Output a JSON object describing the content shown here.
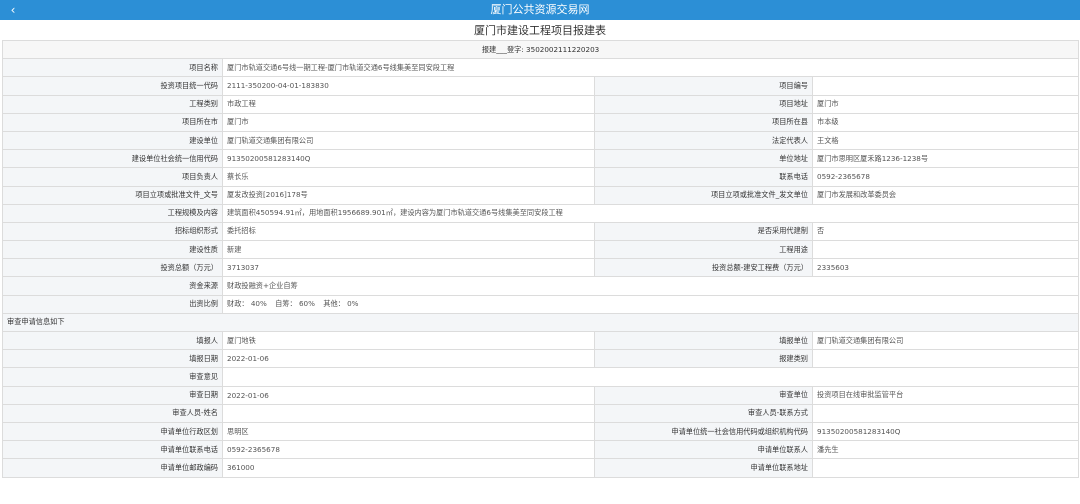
{
  "header": {
    "back_icon": "‹",
    "title": "厦门公共资源交易网"
  },
  "page_title": "厦门市建设工程项目报建表",
  "registration_line": "报建___登字: 3502002111220203",
  "fields": {
    "project_name": {
      "label": "项目名称",
      "value": "厦门市轨道交通6号线一期工程-厦门市轨道交通6号线集美至同安段工程"
    },
    "project_code": {
      "label": "投资项目统一代码",
      "value": "2111-350200-04-01-183830"
    },
    "project_number": {
      "label": "项目编号",
      "value": ""
    },
    "project_category": {
      "label": "工程类别",
      "value": "市政工程"
    },
    "project_address": {
      "label": "项目地址",
      "value": "厦门市"
    },
    "city": {
      "label": "项目所在市",
      "value": "厦门市"
    },
    "county": {
      "label": "项目所在县",
      "value": "市本级"
    },
    "builder": {
      "label": "建设单位",
      "value": "厦门轨道交通集团有限公司"
    },
    "legal_rep": {
      "label": "法定代表人",
      "value": "王文格"
    },
    "credit_code": {
      "label": "建设单位社会统一信用代码",
      "value": "91350200581283140Q"
    },
    "unit_address": {
      "label": "单位地址",
      "value": "厦门市思明区厦禾路1236-1238号"
    },
    "project_leader": {
      "label": "项目负责人",
      "value": "蔡长乐"
    },
    "phone": {
      "label": "联系电话",
      "value": "0592-2365678"
    },
    "approval_doc": {
      "label": "项目立项或批准文件_文号",
      "value": "厦发改投资[2016]178号"
    },
    "approval_unit": {
      "label": "项目立项或批准文件_发文单位",
      "value": "厦门市发展和改革委员会"
    },
    "scale": {
      "label": "工程规模及内容",
      "value": "建筑面积450594.91㎡，用地面积1956689.901㎡，建设内容为厦门市轨道交通6号线集美至同安段工程"
    },
    "bidding_form": {
      "label": "招标组织形式",
      "value": "委托招标"
    },
    "agent_build": {
      "label": "是否采用代建制",
      "value": "否"
    },
    "build_nature": {
      "label": "建设性质",
      "value": "新建"
    },
    "project_use": {
      "label": "工程用途",
      "value": ""
    },
    "total_invest": {
      "label": "投资总额（万元）",
      "value": "3713037"
    },
    "install_cost": {
      "label": "投资总额-建安工程费（万元）",
      "value": "2335603"
    },
    "fund_source": {
      "label": "资金来源",
      "value": "财政投融资+企业自筹"
    },
    "ratio": {
      "label": "出资比例",
      "fiscal": "财政：  40%",
      "self": "自筹：  60%",
      "other": "其他：  0%"
    }
  },
  "review_section": "审查申请信息如下",
  "review": {
    "filler": {
      "label": "填报人",
      "value": "厦门地铁"
    },
    "filler_unit": {
      "label": "填报单位",
      "value": "厦门轨道交通集团有限公司"
    },
    "fill_date": {
      "label": "填报日期",
      "value": "2022-01-06"
    },
    "reg_category": {
      "label": "报建类别",
      "value": ""
    },
    "opinion": {
      "label": "审查意见",
      "value": ""
    },
    "review_date": {
      "label": "审查日期",
      "value": "2022-01-06"
    },
    "review_unit": {
      "label": "审查单位",
      "value": "投资项目在线审批监管平台"
    },
    "reviewer_name": {
      "label": "审查人员-姓名",
      "value": ""
    },
    "reviewer_contact": {
      "label": "审查人员-联系方式",
      "value": ""
    },
    "applicant_region": {
      "label": "申请单位行政区划",
      "value": "思明区"
    },
    "applicant_credit": {
      "label": "申请单位统一社会信用代码或组织机构代码",
      "value": "91350200581283140Q"
    },
    "applicant_phone": {
      "label": "申请单位联系电话",
      "value": "0592-2365678"
    },
    "applicant_contact": {
      "label": "申请单位联系人",
      "value": "潘先生"
    },
    "applicant_zip": {
      "label": "申请单位邮政编码",
      "value": "361000"
    },
    "applicant_address": {
      "label": "申请单位联系地址",
      "value": ""
    }
  },
  "colors": {
    "header_bg": "#2c8fd6",
    "label_bg": "#f4f6f8",
    "border": "#dcdcdc"
  }
}
